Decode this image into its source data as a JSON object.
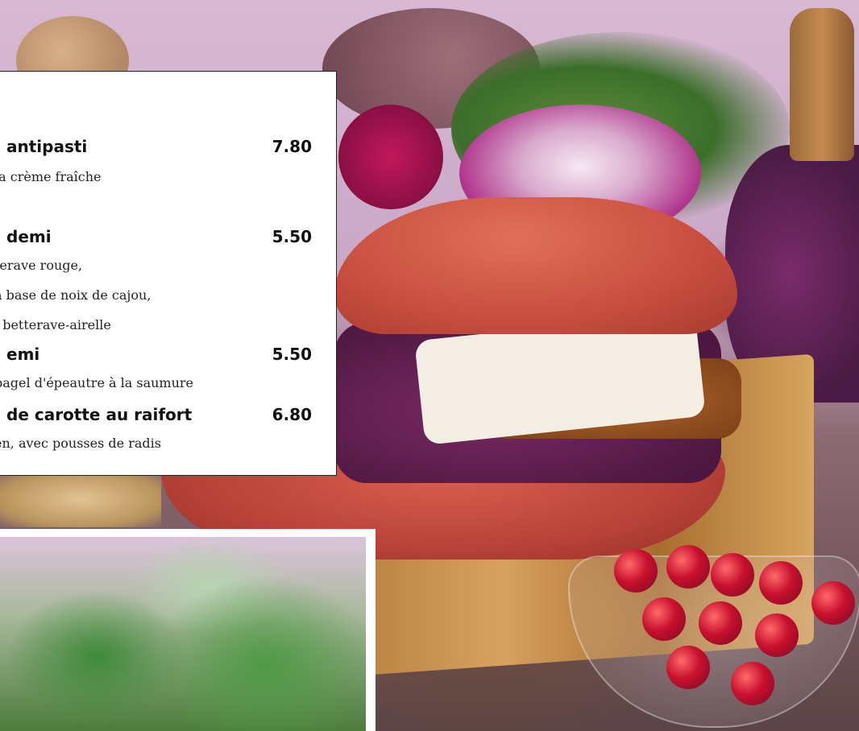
{
  "menu": {
    "items": [
      {
        "title": "antipasti",
        "price": "7.80",
        "desc": [
          "la crème fraîche"
        ]
      },
      {
        "title": "demi",
        "price": "5.50",
        "desc": [
          "terave rouge,",
          "à base de noix de cajou,",
          "l betterave-airelle"
        ]
      },
      {
        "title": "emi",
        "price": "5.50",
        "desc": [
          "bagel d'épeautre à la saumure"
        ]
      },
      {
        "title": "de carotte au raifort",
        "price": "6.80",
        "desc": [
          "en, avec pousses de radis"
        ]
      }
    ]
  },
  "photo": {
    "main_subject": "red-bun-sandwich",
    "inset_subject": "fresh-greens"
  }
}
